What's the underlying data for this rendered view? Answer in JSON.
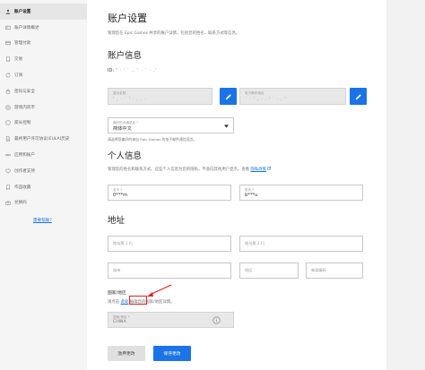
{
  "sidebar": {
    "items": [
      {
        "label": "账户设置",
        "icon": "person-icon",
        "active": true
      },
      {
        "label": "账户详情概述",
        "icon": "id-card-icon"
      },
      {
        "label": "管理付款",
        "icon": "credit-card-icon"
      },
      {
        "label": "交易",
        "icon": "receipt-icon"
      },
      {
        "label": "订阅",
        "icon": "refresh-icon"
      },
      {
        "label": "密码与安全",
        "icon": "lock-icon"
      },
      {
        "label": "游戏内货币",
        "icon": "coin-icon"
      },
      {
        "label": "家长控制",
        "icon": "shield-icon"
      },
      {
        "label": "最终用户许可协议(EULA)历史",
        "icon": "document-icon"
      },
      {
        "label": "应用和账户",
        "icon": "link-icon"
      },
      {
        "label": "创作者支持",
        "icon": "heart-icon"
      },
      {
        "label": "作品收藏",
        "icon": "bookmark-icon"
      },
      {
        "label": "兑换码",
        "icon": "gift-icon"
      }
    ],
    "help_link": "需要帮助?"
  },
  "main": {
    "title": "账户设置",
    "description": "管理您在 Epic Games 共享的账户详情，包括您的姓名、联系方式等信息。",
    "account_info": {
      "heading": "账户信息",
      "id_prefix": "ID:",
      "id_masked": "\" · ' ˙ ., ' · ˙ · ,'",
      "display_name_label": "显示名称",
      "display_name_value": "' , · ˙ ' · , . ·",
      "email_label": "电子邮件地址",
      "email_value": "˙ · ' , · . ' ˙ · , '",
      "language_label": "偏好的沟通语言 *",
      "language_value": "简体中文",
      "language_note": "请选择您偏好的来自 Epic Games 的电子邮件通信语言。"
    },
    "personal_info": {
      "heading": "个人信息",
      "description": "管理您的姓名和联系方式。这些个人信息为您的隐私，不会向其他用户显示。查看",
      "privacy_link": "隐私政策",
      "first_name_label": "名字 *",
      "first_name_value": "0***m",
      "last_name_label": "姓氏 *",
      "last_name_value": "b***u"
    },
    "address": {
      "heading": "地址",
      "line1_placeholder": "地址第 1 行",
      "line2_placeholder": "地址第 2 行",
      "city_placeholder": "城市",
      "region_placeholder": "地区",
      "postal_placeholder": "邮政编码",
      "country_heading": "国家/地区",
      "country_note_prefix": "请点击",
      "country_link": "此处",
      "country_note_suffix": "编辑您的国家/地区详情。",
      "country_label": "国家/地区 *",
      "country_value": "CHINA"
    },
    "buttons": {
      "discard": "放弃更改",
      "save": "保存更改"
    }
  },
  "colors": {
    "accent": "#1a73e8",
    "annotation": "#e02020"
  }
}
